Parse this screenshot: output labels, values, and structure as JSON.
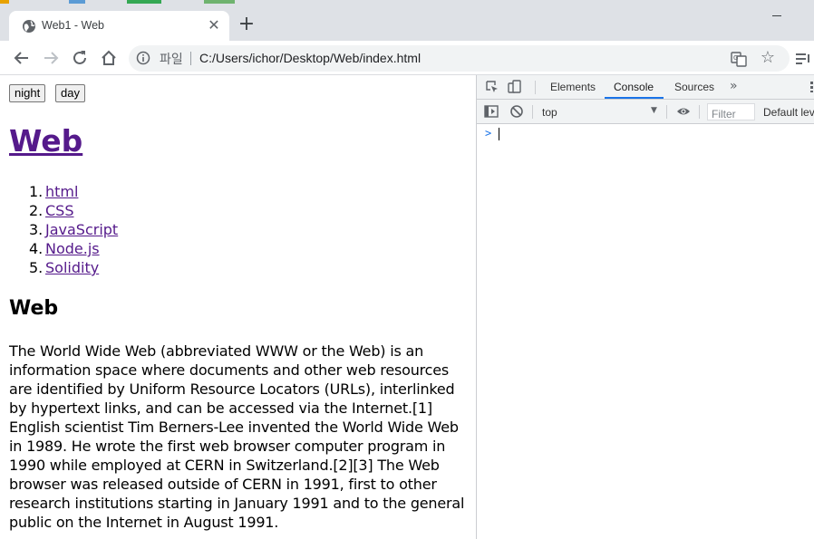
{
  "tab": {
    "title": "Web1 - Web",
    "close_icon": "close-icon",
    "new_tab_glyph": "+"
  },
  "address_bar": {
    "scheme_label": "파일",
    "url": "C:/Users/ichor/Desktop/Web/index.html"
  },
  "page": {
    "buttons": [
      "night",
      "day"
    ],
    "heading": "Web",
    "list": [
      {
        "num": "1.",
        "label": "html"
      },
      {
        "num": "2.",
        "label": "CSS"
      },
      {
        "num": "3.",
        "label": "JavaScript"
      },
      {
        "num": "4.",
        "label": "Node.js"
      },
      {
        "num": "5.",
        "label": "Solidity"
      }
    ],
    "subheading": "Web",
    "paragraph": "The World Wide Web (abbreviated WWW or the Web) is an information space where documents and other web resources are identified by Uniform Resource Locators (URLs), interlinked by hypertext links, and can be accessed via the Internet.[1] English scientist Tim Berners-Lee invented the World Wide Web in 1989. He wrote the first web browser computer program in 1990 while employed at CERN in Switzerland.[2][3] The Web browser was released outside of CERN in 1991, first to other research institutions starting in January 1991 and to the general public on the Internet in August 1991."
  },
  "devtools": {
    "tabs": [
      "Elements",
      "Console",
      "Sources"
    ],
    "active_tab": "Console",
    "more_glyph": "»",
    "context": "top",
    "filter_placeholder": "Filter",
    "levels_label": "Default levels",
    "prompt_glyph": ">"
  },
  "colors": {
    "visited_link": "#551a8b",
    "accent": "#1a73e8",
    "chrome_frame": "#dee1e6"
  }
}
